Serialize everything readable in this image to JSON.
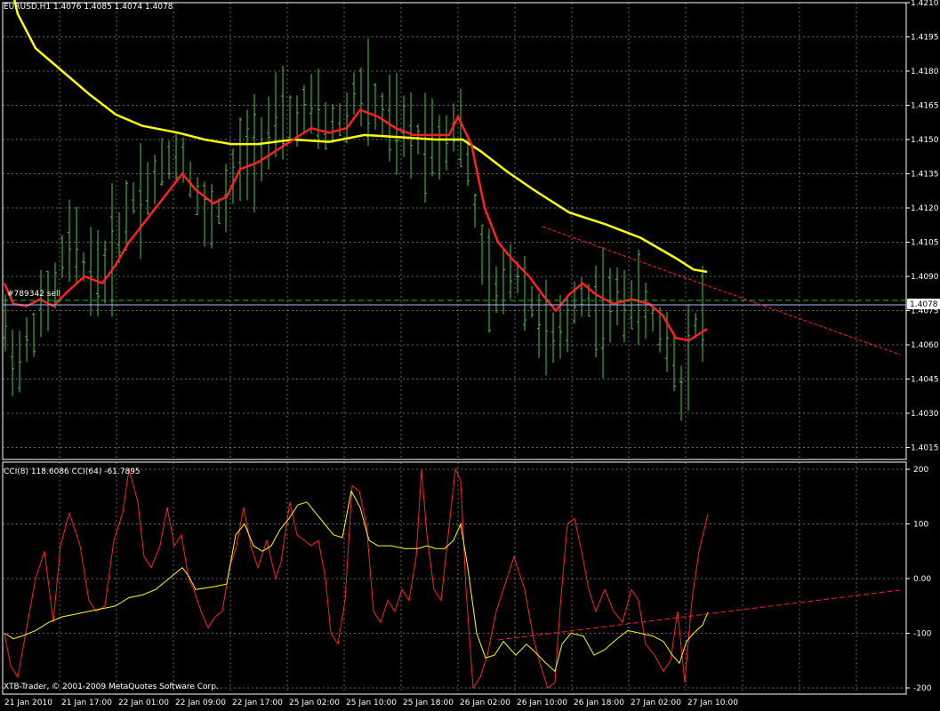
{
  "main": {
    "symbol_label": "EURUSD,H1  1.4076  1.4085  1.4074  1.4078",
    "price_ticks": [
      "1.4210",
      "1.4195",
      "1.4180",
      "1.4165",
      "1.4150",
      "1.4135",
      "1.4120",
      "1.4105",
      "1.4090",
      "1.4075",
      "1.4060",
      "1.4045",
      "1.4030",
      "1.4015"
    ],
    "current_price": "1.4078",
    "order_label": "#789342 sell",
    "colors": {
      "bars": "#44cc44",
      "ma_fast": "#ff2020",
      "ma_slow": "#ffff00",
      "grid": "#c0c0c0",
      "trendline": "#ff2020",
      "order_line": "#00cc00",
      "price_line": "#b0b0ff"
    }
  },
  "sub": {
    "indicator_label": "CCI(8) 118.6086  CCI(64) -61.7895",
    "cci_ticks": [
      "200",
      "100",
      "0.00",
      "-100",
      "-200"
    ],
    "colors": {
      "cci_fast": "#ff2020",
      "cci_slow": "#ffff00"
    }
  },
  "time_axis": {
    "labels": [
      "21 Jan 2010",
      "21 Jan 17:00",
      "22 Jan 01:00",
      "22 Jan 09:00",
      "22 Jan 17:00",
      "25 Jan 02:00",
      "25 Jan 10:00",
      "25 Jan 18:00",
      "26 Jan 02:00",
      "26 Jan 10:00",
      "26 Jan 18:00",
      "27 Jan 02:00",
      "27 Jan 10:00"
    ]
  },
  "copyright": "XTB-Trader, © 2001-2009 MetaQuotes Software Corp."
}
